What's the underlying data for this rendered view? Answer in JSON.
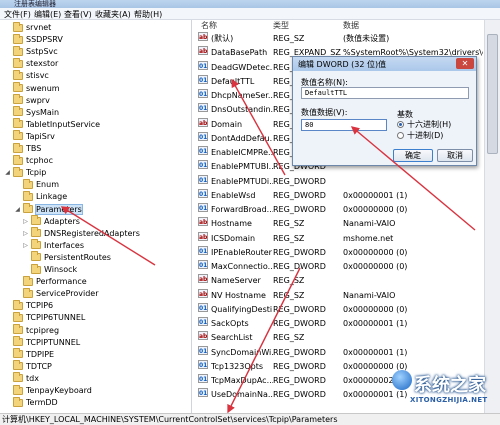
{
  "window": {
    "title": "注册表编辑器"
  },
  "menu": [
    "文件(F)",
    "编辑(E)",
    "查看(V)",
    "收藏夹(A)",
    "帮助(H)"
  ],
  "tree": {
    "items": [
      {
        "label": "srvnet",
        "exp": "",
        "level": 0
      },
      {
        "label": "SSDPSRV",
        "exp": "",
        "level": 0
      },
      {
        "label": "SstpSvc",
        "exp": "",
        "level": 0
      },
      {
        "label": "stexstor",
        "exp": "",
        "level": 0
      },
      {
        "label": "stisvc",
        "exp": "",
        "level": 0
      },
      {
        "label": "swenum",
        "exp": "",
        "level": 0
      },
      {
        "label": "swprv",
        "exp": "",
        "level": 0
      },
      {
        "label": "SysMain",
        "exp": "",
        "level": 0
      },
      {
        "label": "TabletInputService",
        "exp": "",
        "level": 0
      },
      {
        "label": "TapiSrv",
        "exp": "",
        "level": 0
      },
      {
        "label": "TBS",
        "exp": "",
        "level": 0
      },
      {
        "label": "tcphoc",
        "exp": "",
        "level": 0
      },
      {
        "label": "Tcpip",
        "exp": "◢",
        "level": 0
      },
      {
        "label": "Enum",
        "exp": "",
        "level": 1
      },
      {
        "label": "Linkage",
        "exp": "",
        "level": 1
      },
      {
        "label": "Parameters",
        "exp": "◢",
        "level": 1
      },
      {
        "label": "Adapters",
        "exp": "▷",
        "level": 2
      },
      {
        "label": "DNSRegisteredAdapters",
        "exp": "▷",
        "level": 2
      },
      {
        "label": "Interfaces",
        "exp": "▷",
        "level": 2
      },
      {
        "label": "PersistentRoutes",
        "exp": "",
        "level": 2
      },
      {
        "label": "Winsock",
        "exp": "",
        "level": 2
      },
      {
        "label": "Performance",
        "exp": "",
        "level": 1
      },
      {
        "label": "ServiceProvider",
        "exp": "",
        "level": 1
      },
      {
        "label": "TCPIP6",
        "exp": "",
        "level": 0
      },
      {
        "label": "TCPIP6TUNNEL",
        "exp": "",
        "level": 0
      },
      {
        "label": "tcpipreg",
        "exp": "",
        "level": 0
      },
      {
        "label": "TCPIPTUNNEL",
        "exp": "",
        "level": 0
      },
      {
        "label": "TDPIPE",
        "exp": "",
        "level": 0
      },
      {
        "label": "TDTCP",
        "exp": "",
        "level": 0
      },
      {
        "label": "tdx",
        "exp": "",
        "level": 0
      },
      {
        "label": "TenpayKeyboard",
        "exp": "",
        "level": 0
      },
      {
        "label": "TermDD",
        "exp": "",
        "level": 0
      }
    ]
  },
  "values": {
    "headers": {
      "name": "名称",
      "type": "类型",
      "data": "数据"
    },
    "rows": [
      {
        "icon": "ab",
        "name": "(默认)",
        "type": "REG_SZ",
        "data": "(数值未设置)"
      },
      {
        "icon": "ab",
        "name": "DataBasePath",
        "type": "REG_EXPAND_SZ",
        "data": "%SystemRoot%\\System32\\drivers\\etc"
      },
      {
        "icon": "bin",
        "name": "DeadGWDetec...",
        "type": "REG_DWORD",
        "data": ""
      },
      {
        "icon": "bin",
        "name": "DefaultTTL",
        "type": "REG_DWORD",
        "data": ""
      },
      {
        "icon": "bin",
        "name": "DhcpNameSer...",
        "type": "REG_SZ",
        "data": ""
      },
      {
        "icon": "bin",
        "name": "DnsOutstandin...",
        "type": "REG_DWORD",
        "data": ""
      },
      {
        "icon": "ab",
        "name": "Domain",
        "type": "REG_SZ",
        "data": ""
      },
      {
        "icon": "bin",
        "name": "DontAddDefau...",
        "type": "REG_DWORD",
        "data": ""
      },
      {
        "icon": "bin",
        "name": "EnableICMPRe...",
        "type": "REG_DWORD",
        "data": ""
      },
      {
        "icon": "bin",
        "name": "EnablePMTUBI...",
        "type": "REG_DWORD",
        "data": ""
      },
      {
        "icon": "bin",
        "name": "EnablePMTUDi...",
        "type": "REG_DWORD",
        "data": ""
      },
      {
        "icon": "bin",
        "name": "EnableWsd",
        "type": "REG_DWORD",
        "data": "0x00000001 (1)"
      },
      {
        "icon": "bin",
        "name": "ForwardBroad...",
        "type": "REG_DWORD",
        "data": "0x00000000 (0)"
      },
      {
        "icon": "ab",
        "name": "Hostname",
        "type": "REG_SZ",
        "data": "Nanami-VAIO"
      },
      {
        "icon": "ab",
        "name": "ICSDomain",
        "type": "REG_SZ",
        "data": "mshome.net"
      },
      {
        "icon": "bin",
        "name": "IPEnableRouter",
        "type": "REG_DWORD",
        "data": "0x00000000 (0)"
      },
      {
        "icon": "bin",
        "name": "MaxConnectio...",
        "type": "REG_DWORD",
        "data": "0x00000000 (0)"
      },
      {
        "icon": "ab",
        "name": "NameServer",
        "type": "REG_SZ",
        "data": ""
      },
      {
        "icon": "ab",
        "name": "NV Hostname",
        "type": "REG_SZ",
        "data": "Nanami-VAIO"
      },
      {
        "icon": "bin",
        "name": "QualifyingDesti...",
        "type": "REG_DWORD",
        "data": "0x00000000 (0)"
      },
      {
        "icon": "bin",
        "name": "SackOpts",
        "type": "REG_DWORD",
        "data": "0x00000001 (1)"
      },
      {
        "icon": "ab",
        "name": "SearchList",
        "type": "REG_SZ",
        "data": ""
      },
      {
        "icon": "bin",
        "name": "SyncDomainWi...",
        "type": "REG_DWORD",
        "data": "0x00000001 (1)"
      },
      {
        "icon": "bin",
        "name": "Tcp1323Opts",
        "type": "REG_DWORD",
        "data": "0x00000000 (0)"
      },
      {
        "icon": "bin",
        "name": "TcpMaxDupAc...",
        "type": "REG_DWORD",
        "data": "0x00000002 (2)"
      },
      {
        "icon": "bin",
        "name": "UseDomainNa...",
        "type": "REG_DWORD",
        "data": "0x00000001 (1)"
      }
    ]
  },
  "dialog": {
    "title": "编辑 DWORD (32 位)值",
    "close": "✕",
    "name_label": "数值名称(N):",
    "name_value": "DefaultTTL",
    "data_label": "数值数据(V):",
    "data_value": "80",
    "base_label": "基数",
    "hex_label": "十六进制(H)",
    "dec_label": "十进制(D)",
    "ok": "确定",
    "cancel": "取消"
  },
  "status": {
    "path": "计算机\\HKEY_LOCAL_MACHINE\\SYSTEM\\CurrentControlSet\\services\\Tcpip\\Parameters"
  },
  "watermark": {
    "main": "系统之家",
    "sub": "XITONGZHIJIA.NET"
  },
  "colors": {
    "arrow": "#d9333f",
    "selection": "#cde3f8",
    "title_bar": "#aac7ea"
  }
}
